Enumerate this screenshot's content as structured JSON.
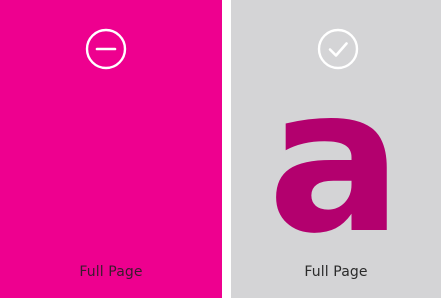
{
  "cards": [
    {
      "id": "left",
      "label": "Full Page",
      "state_icon": "minus-circle-icon",
      "background": "#ee008f",
      "selected": false
    },
    {
      "id": "right",
      "label": "Full Page",
      "state_icon": "check-circle-icon",
      "background": "#d4d4d6",
      "preview_glyph": "a",
      "glyph_color": "#b3006e",
      "selected": true
    }
  ]
}
